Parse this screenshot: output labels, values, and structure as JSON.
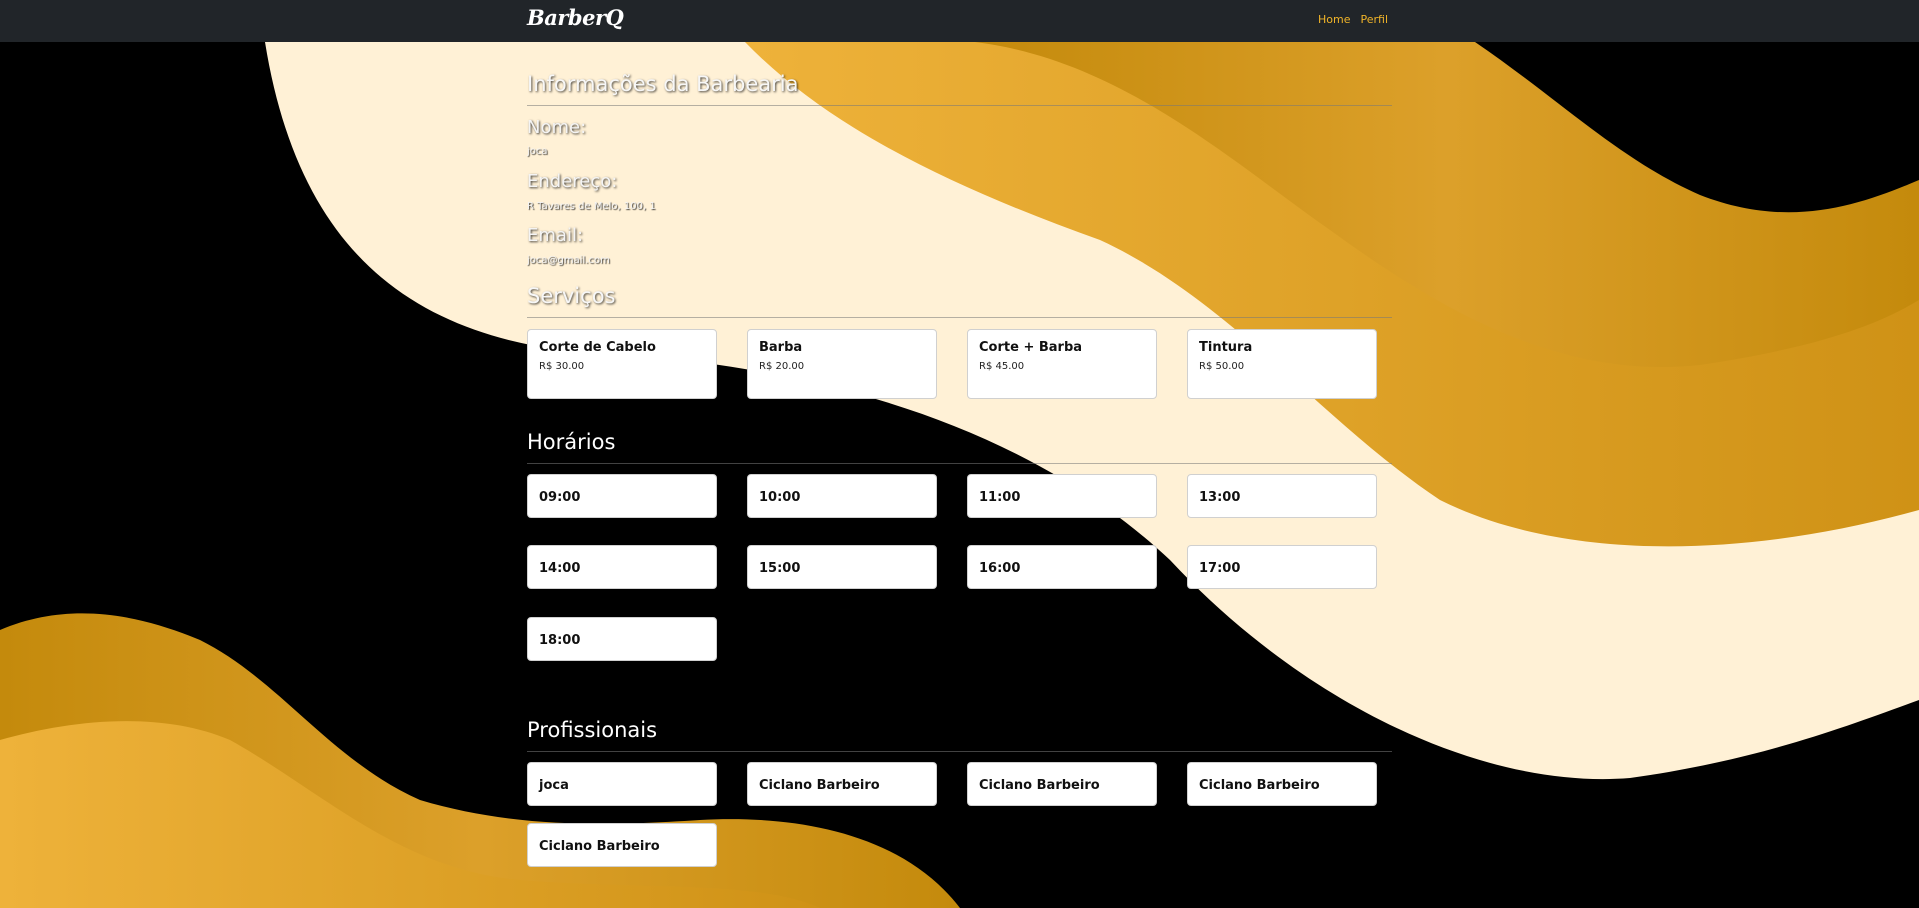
{
  "navbar": {
    "brand": "BarberQ",
    "links": [
      {
        "label": "Home"
      },
      {
        "label": "Perfil"
      }
    ]
  },
  "info": {
    "title": "Informações da Barbearia",
    "nome_label": "Nome:",
    "nome_value": "joca",
    "endereco_label": "Endereço:",
    "endereco_value": "R Tavares de Melo, 100, 1",
    "email_label": "Email:",
    "email_value": "joca@gmail.com"
  },
  "servicos": {
    "title": "Serviços",
    "items": [
      {
        "name": "Corte de Cabelo",
        "price": "R$ 30.00"
      },
      {
        "name": "Barba",
        "price": "R$ 20.00"
      },
      {
        "name": "Corte + Barba",
        "price": "R$ 45.00"
      },
      {
        "name": "Tintura",
        "price": "R$ 50.00"
      }
    ]
  },
  "horarios": {
    "title": "Horários",
    "slots": [
      "09:00",
      "10:00",
      "11:00",
      "13:00",
      "14:00",
      "15:00",
      "16:00",
      "17:00",
      "18:00"
    ]
  },
  "profissionais": {
    "title": "Profissionais",
    "items": [
      "joca",
      "Ciclano Barbeiro",
      "Ciclano Barbeiro",
      "Ciclano Barbeiro",
      "Ciclano Barbeiro"
    ]
  },
  "colors": {
    "navbar_bg": "#212529",
    "link": "#f0b429",
    "cream": "#fff1d6",
    "gold_dark": "#c48a0c",
    "gold_light": "#eeb23a"
  }
}
